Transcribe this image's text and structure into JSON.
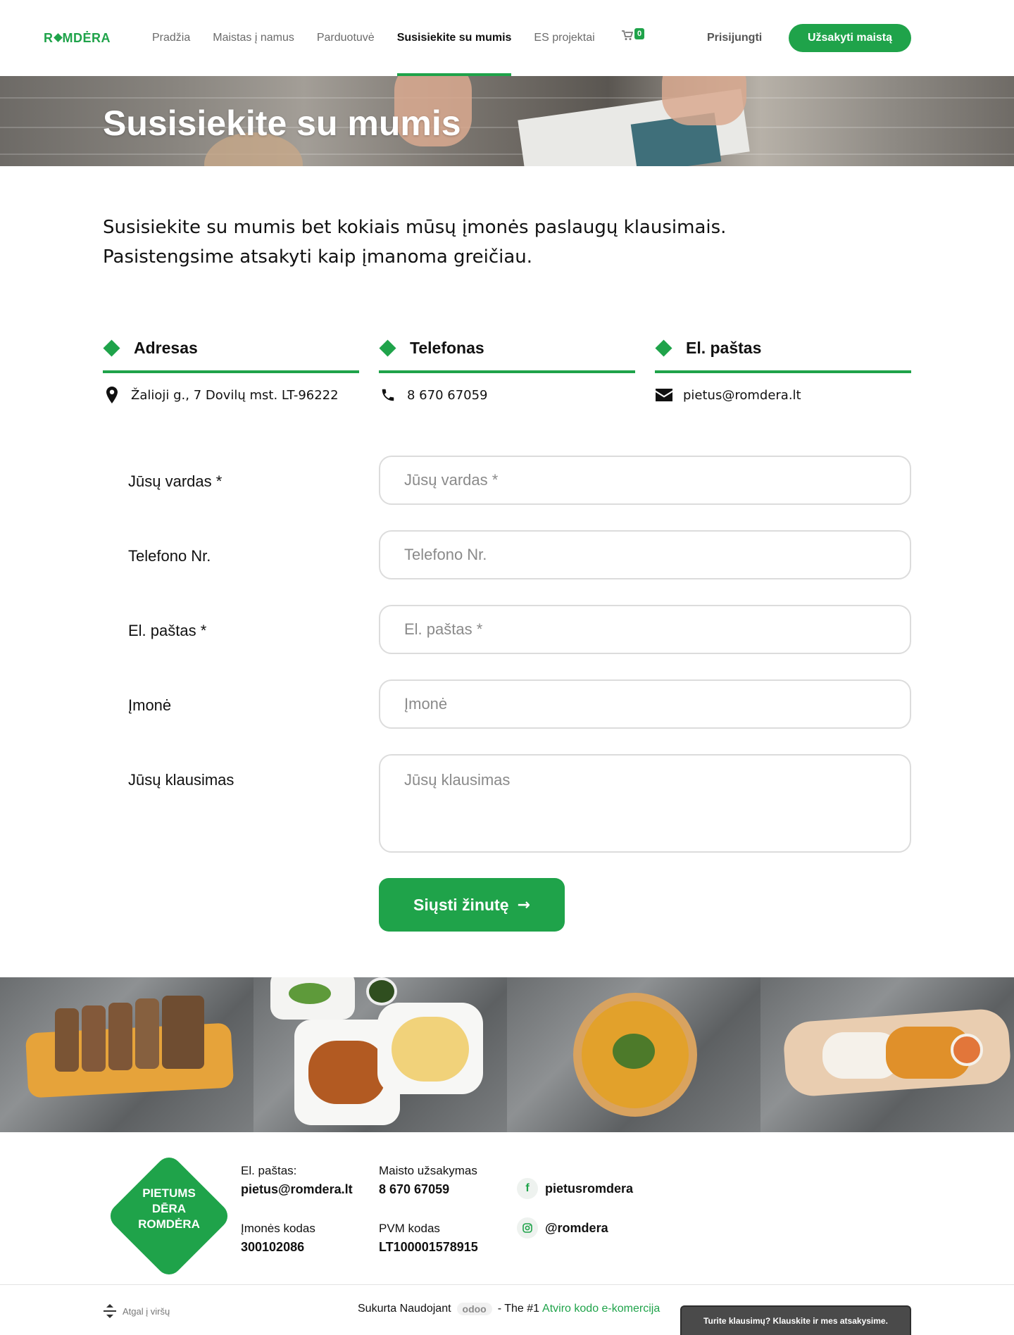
{
  "header": {
    "logo": "RⓄMDĖRA",
    "nav": [
      "Pradžia",
      "Maistas į namus",
      "Parduotuvė",
      "Susisiekite su mumis",
      "ES projektai"
    ],
    "cart_count": "0",
    "login": "Prisijungti",
    "order_button": "Užsakyti maistą"
  },
  "hero": {
    "title": "Susisiekite su mumis"
  },
  "intro": {
    "line1": "Susisiekite su mumis bet kokiais mūsų įmonės paslaugų klausimais.",
    "line2": "Pasistengsime atsakyti kaip įmanoma greičiau."
  },
  "contact": {
    "address": {
      "title": "Adresas",
      "value": "Žalioji g., 7 Dovilų mst. LT-96222",
      "icon": "map-marker-icon"
    },
    "phone": {
      "title": "Telefonas",
      "value": "8 670 67059",
      "icon": "phone-icon"
    },
    "email": {
      "title": "El. paštas",
      "value": "pietus@romdera.lt",
      "icon": "envelope-icon"
    }
  },
  "form": {
    "name": {
      "label": "Jūsų vardas *",
      "placeholder": "Jūsų vardas *"
    },
    "phone": {
      "label": "Telefono Nr.",
      "placeholder": "Telefono Nr."
    },
    "email": {
      "label": "El. paštas *",
      "placeholder": "El. paštas *"
    },
    "company": {
      "label": "Įmonė",
      "placeholder": "Įmonė"
    },
    "question": {
      "label": "Jūsų klausimas",
      "placeholder": "Jūsų klausimas"
    },
    "submit": "Siųsti žinutę",
    "submit_arrow": "→"
  },
  "footer": {
    "logo_lines": [
      "PIETUMS",
      "DĒRA",
      "ROMDĖRA"
    ],
    "email_label": "El. paštas:",
    "email_value": "pietus@romdera.lt",
    "order_label": "Maisto užsakymas",
    "order_value": "8 670 67059",
    "company_code_label": "Įmonės kodas",
    "company_code_value": "300102086",
    "vat_label": "PVM kodas",
    "vat_value": "LT100001578915",
    "facebook": "pietusromdera",
    "instagram": "@romdera",
    "back_to_top": "Atgal į viršų",
    "credits_prefix": "Sukurta Naudojant",
    "odoo": "odoo",
    "credits_mid": "- The #1",
    "credits_link": "Atviro kodo e-komercija",
    "chat": "Turite klausimų? Klauskite ir mes atsakysime."
  },
  "colors": {
    "brand_green": "#1fa34a"
  }
}
